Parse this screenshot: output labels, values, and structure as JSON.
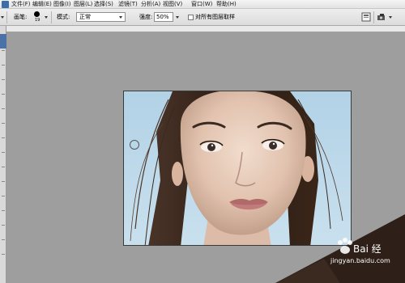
{
  "menubar": {
    "items": [
      {
        "label": "文件(F)"
      },
      {
        "label": "编辑(E)"
      },
      {
        "label": "图像(I)"
      },
      {
        "label": "图层(L)"
      },
      {
        "label": "选择(S)"
      },
      {
        "label": "滤镜(T)"
      },
      {
        "label": "分析(A)"
      },
      {
        "label": "视图(V)"
      },
      {
        "label": "窗口(W)"
      },
      {
        "label": "帮助(H)"
      }
    ]
  },
  "options": {
    "brush_label": "画笔:",
    "brush_size": "19",
    "mode_label": "模式:",
    "mode_value": "正常",
    "strength_label": "强度:",
    "strength_value": "50%",
    "all_layers_label": "对所有图层取样",
    "all_layers_checked": false
  },
  "canvas": {
    "photo_subject": "portrait-of-woman",
    "background_color": "#9e9e9e"
  },
  "watermark": {
    "brand": "Bai 经验",
    "url": "jingyan.baidu.com"
  }
}
